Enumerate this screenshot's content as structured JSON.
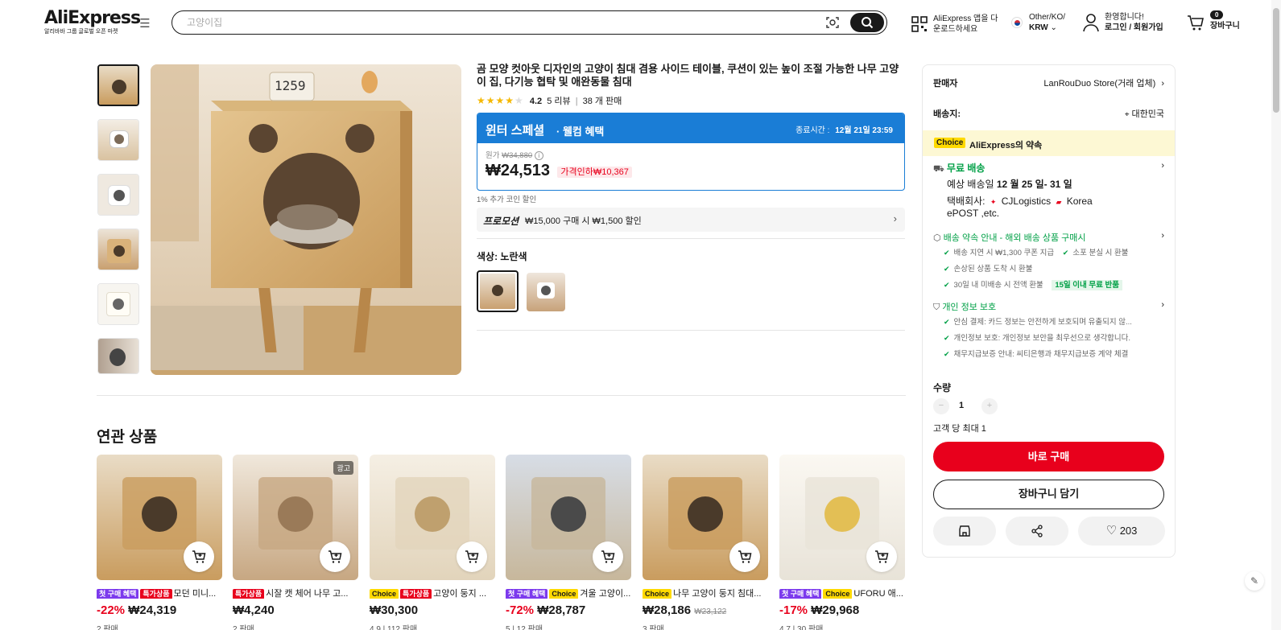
{
  "header": {
    "logo": "AliExpress",
    "logo_tagline": "알리바바 그룹 글로벌 오픈 마켓",
    "search_placeholder": "고양이집",
    "app_promo": "AliExpress 앱을 다운로드하세요",
    "app_promo_line1": "AliExpress 앱을 다",
    "app_promo_line2": "운로드하세요",
    "region_line1": "Other/KO/",
    "region_currency": "KRW",
    "greeting": "환영합니다!",
    "login": "로그인 / 회원가입",
    "cart_count": "0",
    "cart_label": "장바구니"
  },
  "product": {
    "title": "곰 모양 컷아웃 디자인의 고양이 침대 겸용 사이드 테이블, 쿠션이 있는 높이 조절 가능한 나무 고양이 집, 다기능 협탁 및 애완동물 침대",
    "rating": "4.2",
    "reviews": "5 리뷰",
    "sold": "38 개 판매",
    "promo_title": "윈터 스페셜",
    "promo_sub": "· 웰컴 혜택",
    "promo_end_label": "종료시간 :",
    "promo_end": "12월 21일 23:59",
    "original_label": "원가",
    "original_price": "₩34,880",
    "price": "₩24,513",
    "discount_tag": "가격인하₩10,367",
    "coin_note": "1% 추가 코인 할인",
    "coupon_label": "프로모션",
    "coupon_text": "₩15,000 구매 시 ₩1,500 할인",
    "color_label": "색상: 노란색"
  },
  "side": {
    "seller_label": "판매자",
    "seller_value": "LanRouDuo Store(거래 업체)",
    "ship_to_label": "배송지:",
    "ship_to_value": "대한민국",
    "choice_badge": "Choice",
    "choice_text": "AliExpress의 약속",
    "free_ship": "무료 배송",
    "delivery_prefix": "예상 배송일 ",
    "delivery_date": "12 월 25 일- 31 일",
    "carrier_label": "택배회사:",
    "carrier1": "CJLogistics",
    "carrier2": "Korea",
    "carrier3": "ePOST ,etc.",
    "guarantee_title": "배송 약속 안내 - 해외 배송 상품 구매시",
    "g1": "배송 지연 시 ₩1,300 쿠폰 지급",
    "g2": "소포 분실 시 환불",
    "g3": "손상된 상품 도착 시 환불",
    "g4": "30일 내 미배송 시 전액 환불",
    "g4_badge": "15일 이내 무료 반품",
    "privacy_title": "개인 정보 보호",
    "p1": "안심 결제: 카드 정보는 안전하게 보호되며 유출되지 않...",
    "p2": "개인정보 보호: 개인정보 보안을 최우선으로 생각합니다.",
    "p3": "채무지급보증 안내: 씨티은행과 채무지급보증 계약 체결",
    "qty_label": "수량",
    "qty_value": "1",
    "qty_limit": "고객 당 최대 1",
    "buy_now": "바로 구매",
    "add_cart": "장바구니 담기",
    "wish_count": "203"
  },
  "related": {
    "title": "연관 상품",
    "items": [
      {
        "badges": [
          "첫 구매 혜택",
          "특가상품"
        ],
        "name": "모던 미니...",
        "pct": "-22%",
        "price": "₩24,319",
        "old": "",
        "meta": "2 판매"
      },
      {
        "badges": [
          "특가상품"
        ],
        "name": "시잘 캣 체어 나무 고...",
        "pct": "",
        "price": "₩4,240",
        "old": "",
        "meta": "2 판매",
        "ad": "광고"
      },
      {
        "badges": [
          "Choice",
          "특가상품"
        ],
        "name": "고양이 둥지 ...",
        "pct": "",
        "price": "₩30,300",
        "old": "",
        "meta": "4.9 | 112 판매"
      },
      {
        "badges": [
          "첫 구매 혜택",
          "Choice"
        ],
        "name": "겨울 고양이...",
        "pct": "-72%",
        "price": "₩28,787",
        "old": "",
        "meta": "5 | 12 판매"
      },
      {
        "badges": [
          "Choice"
        ],
        "name": "나무 고양이 둥지 침대...",
        "pct": "",
        "price": "₩28,186",
        "old": "₩23,122",
        "meta": "3 판매"
      },
      {
        "badges": [
          "첫 구매 혜택",
          "Choice"
        ],
        "name": "UFORU 애...",
        "pct": "-17%",
        "price": "₩29,968",
        "old": "",
        "meta": "4.7 | 30 판매"
      }
    ]
  },
  "colors": {
    "brand_red": "#e8001c",
    "promo_blue": "#1a7dd6",
    "green": "#00a046"
  }
}
